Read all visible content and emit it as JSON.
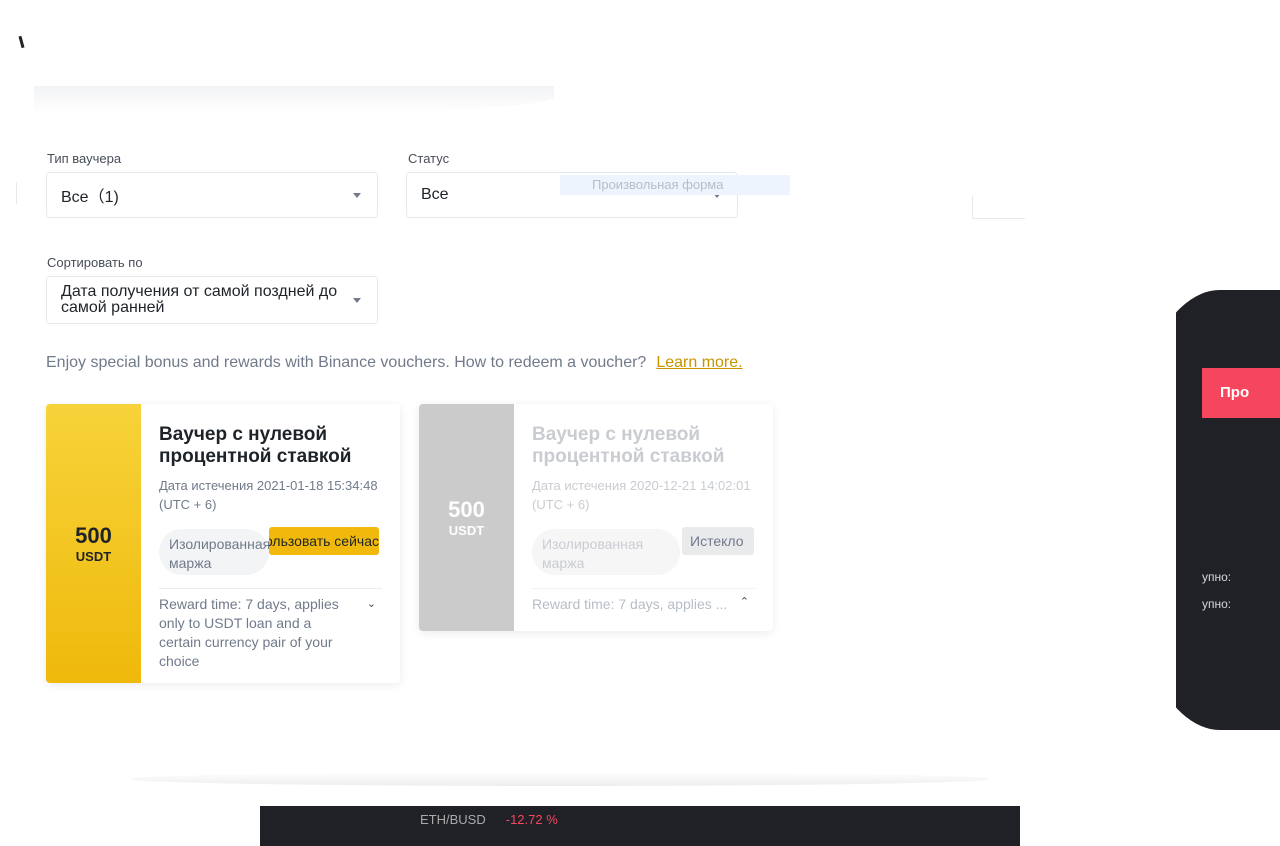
{
  "filters": {
    "voucher_type_label": "Тип ваучера",
    "voucher_type_value": "Все（1)",
    "status_label": "Статус",
    "status_value": "Все",
    "status_tooltip": "Произвольная форма",
    "sort_label": "Сортировать по",
    "sort_value": "Дата получения от самой поздней до самой ранней"
  },
  "info": {
    "text": "Enjoy special bonus and rewards with Binance vouchers. How to redeem a voucher?",
    "link": "Learn more."
  },
  "vouchers": [
    {
      "amount": "500",
      "currency": "USDT",
      "title": "Ваучер с нулевой процентной ставкой",
      "expiry": "Дата истечения  2021-01-18 15:34:48 (UTC + 6)",
      "tag": "Изолированная маржа",
      "action": "Использовать сейчас",
      "reward": "Reward time: 7 days, applies only to USDT loan and a certain currency pair of your choice"
    },
    {
      "amount": "500",
      "currency": "USDT",
      "title": "Ваучер с нулевой процентной ставкой",
      "expiry": "Дата истечения  2020-12-21 14:02:01 (UTC + 6)",
      "tag": "Изолированная маржа",
      "action": "Истекло",
      "reward": "Reward time: 7 days, applies ..."
    }
  ],
  "background": {
    "red_button": "Про",
    "available_1": "упно:",
    "available_2": "упно:",
    "ticker": "ETH/BUSD",
    "ticker_change": "-12.72 %"
  },
  "colors": {
    "accent": "#f0b90b",
    "link": "#c99400",
    "sell": "#f6465d"
  },
  "icons": [
    "caret-down-icon",
    "chevron-down-icon",
    "chevron-up-icon"
  ]
}
